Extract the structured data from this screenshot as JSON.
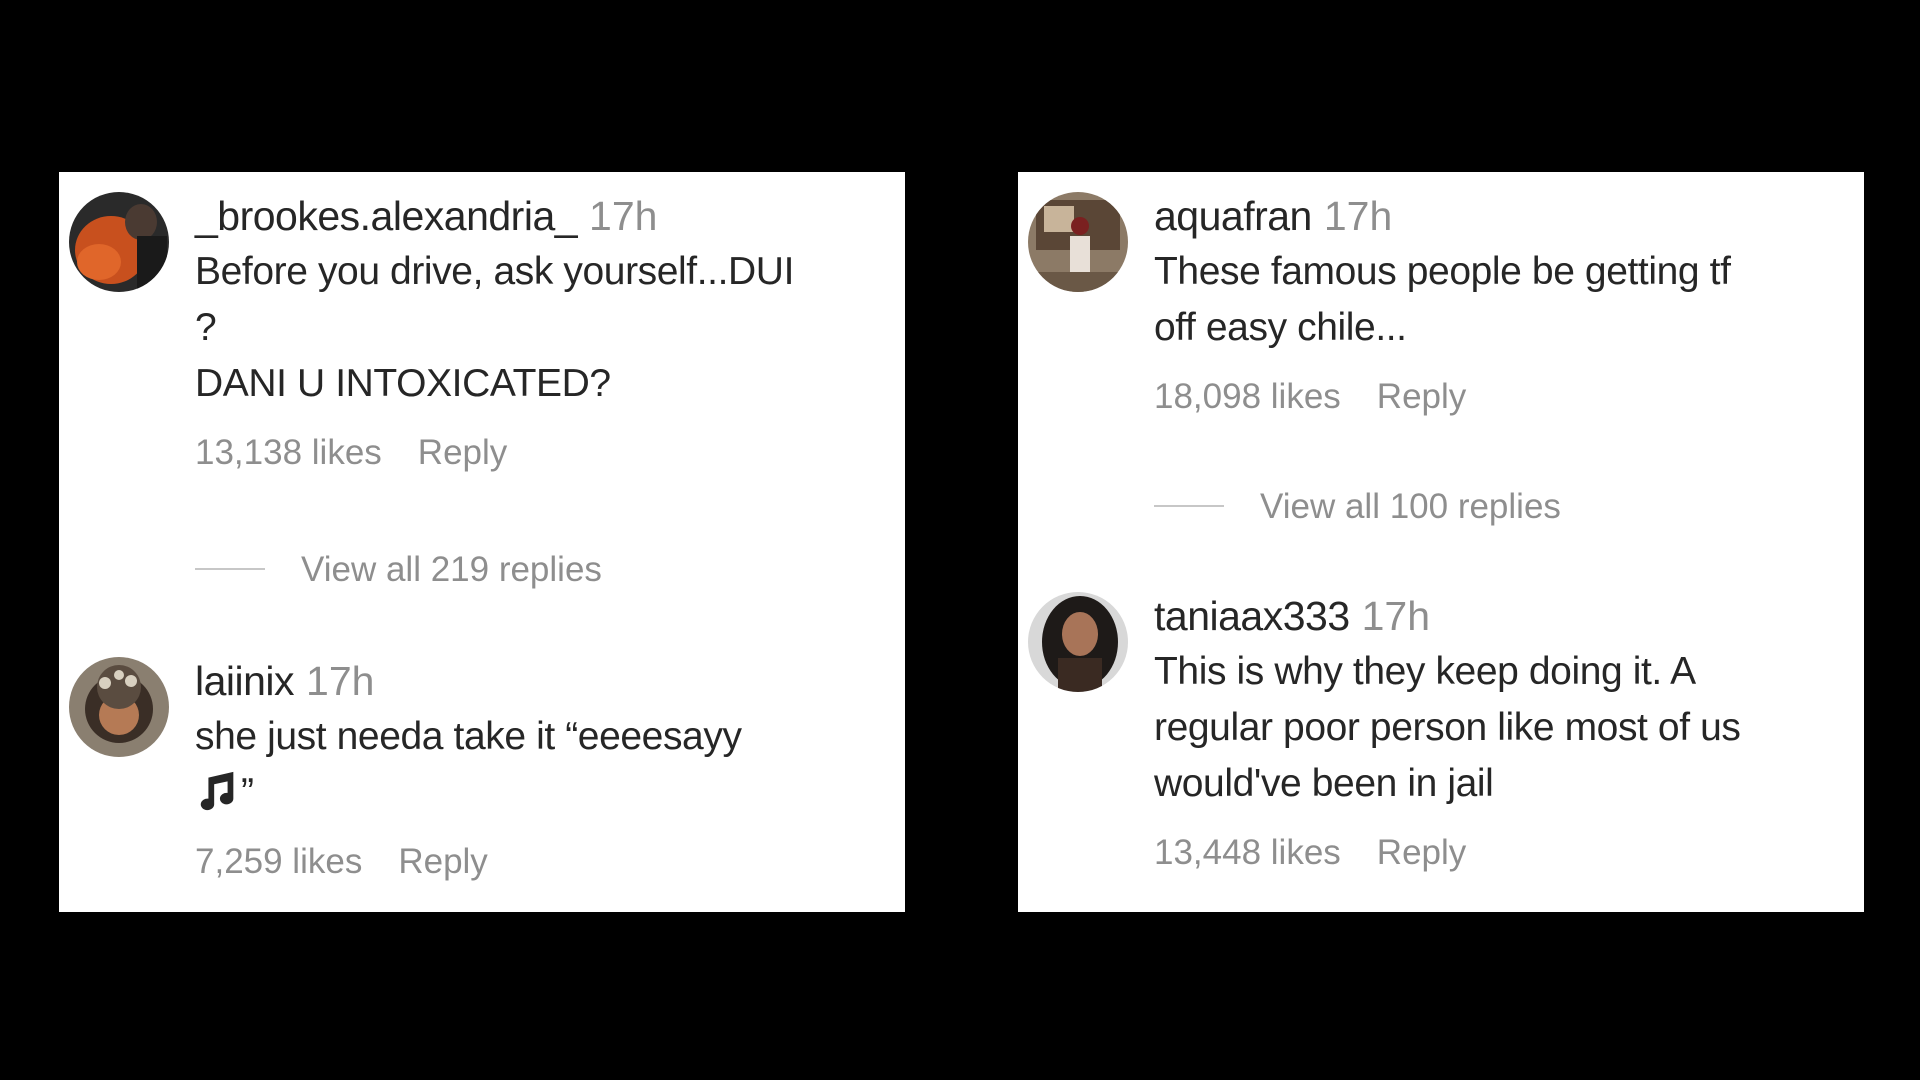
{
  "panels": [
    {
      "comments": [
        {
          "username": "_brookes.alexandria_",
          "time": "17h",
          "text": "Before you drive, ask yourself...DUI\n?\nDANI U INTOXICATED?",
          "likes": "13,138 likes",
          "reply_label": "Reply"
        },
        {
          "username": "laiinix",
          "time": "17h",
          "text_line1": "she just needa take it “eeeesayy",
          "text_line2_suffix": "”",
          "emoji_icon": "musical-notes-icon",
          "likes": "7,259 likes",
          "reply_label": "Reply"
        }
      ],
      "view_replies": "View all 219 replies"
    },
    {
      "comments": [
        {
          "username": "aquafran",
          "time": "17h",
          "text": "These famous people be getting tf\noff easy chile...",
          "likes": "18,098 likes",
          "reply_label": "Reply"
        },
        {
          "username": "taniaax333",
          "time": "17h",
          "text": "This is why they keep doing it. A\nregular poor person like most of us\nwould've been in jail",
          "likes": "13,448 likes",
          "reply_label": "Reply"
        }
      ],
      "view_replies": "View all 100 replies"
    }
  ],
  "colors": {
    "background": "#000000",
    "panel": "#ffffff",
    "primary_text": "#262626",
    "secondary_text": "#8e8e8e"
  }
}
